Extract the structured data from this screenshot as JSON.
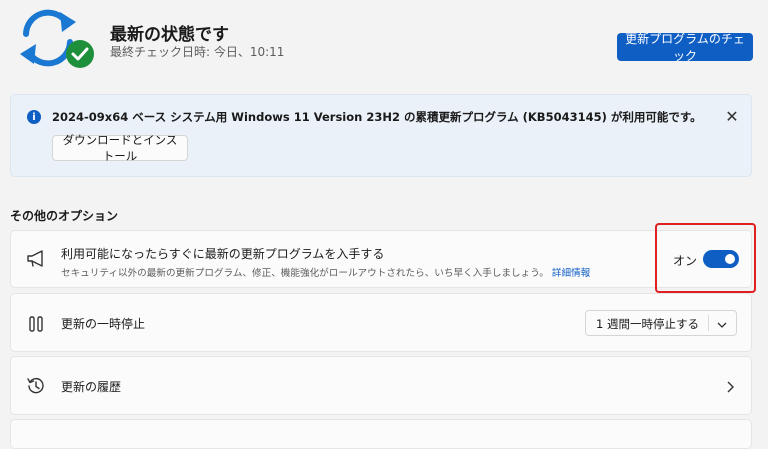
{
  "header": {
    "title": "最新の状態です",
    "subtitle": "最終チェック日時: 今日、10:11",
    "check_button": "更新プログラムのチェック"
  },
  "infobar": {
    "icon": "info-icon",
    "text": "2024-09x64 ベース システム用 Windows 11 Version 23H2 の累積更新プログラム (KB5043145) が利用可能です。",
    "download_button": "ダウンロードとインストール"
  },
  "section": {
    "title": "その他のオプション"
  },
  "options": {
    "latest": {
      "title": "利用可能になったらすぐに最新の更新プログラムを入手する",
      "description": "セキュリティ以外の最新の更新プログラム、修正、機能強化がロールアウトされたら、いち早く入手しましょう。",
      "link": "詳細情報",
      "toggle_label": "オン",
      "toggle_on": true
    },
    "pause": {
      "title": "更新の一時停止",
      "select_value": "1 週間一時停止する"
    },
    "history": {
      "title": "更新の履歴"
    }
  },
  "colors": {
    "accent": "#0f5ec4",
    "highlight": "#e02020",
    "success": "#1e8f3a"
  }
}
